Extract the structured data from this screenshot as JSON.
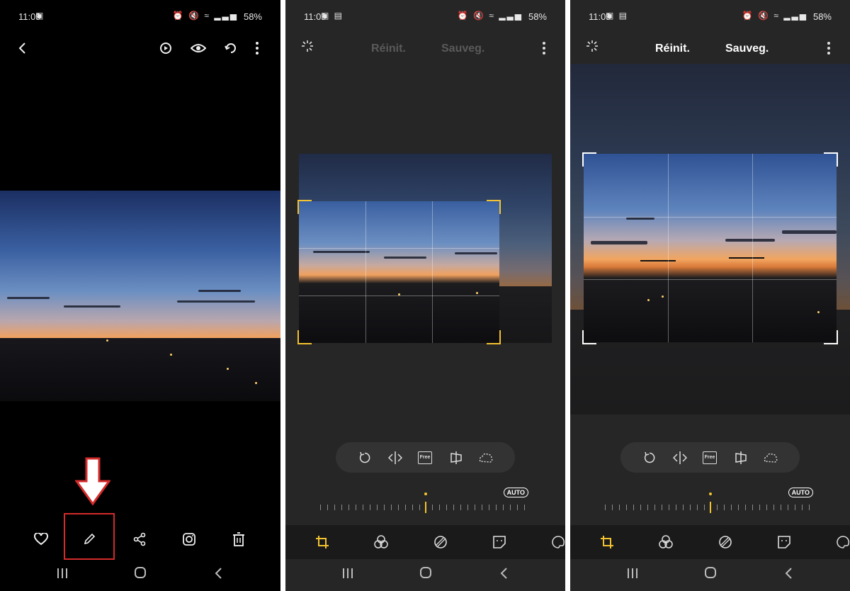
{
  "status": {
    "time": "11:09",
    "battery": "58%"
  },
  "screen2": {
    "reset_label": "Réinit.",
    "save_label": "Sauveg.",
    "auto_label": "AUTO",
    "free_label": "Free"
  },
  "screen3": {
    "reset_label": "Réinit.",
    "save_label": "Sauveg.",
    "auto_label": "AUTO",
    "free_label": "Free"
  },
  "colors": {
    "accent": "#f2c230",
    "highlight": "#d42b2b",
    "disabled_text": "#5a5a5a"
  },
  "icons": {
    "screen1_top": [
      "back-icon",
      "bixby-vision-icon",
      "eye-icon",
      "rotate-icon",
      "more-icon"
    ],
    "screen1_bottom": [
      "heart-icon",
      "edit-pencil-icon",
      "share-icon",
      "instagram-icon",
      "delete-icon"
    ],
    "editor_top": [
      "auto-enhance-icon",
      "more-icon"
    ],
    "editor_tools": [
      "rotate-icon",
      "flip-icon",
      "free-ratio-icon",
      "perspective-icon",
      "lasso-icon"
    ],
    "editor_tabs": [
      "crop-icon",
      "filters-icon",
      "adjust-icon",
      "sticker-icon",
      "paint-icon"
    ]
  }
}
